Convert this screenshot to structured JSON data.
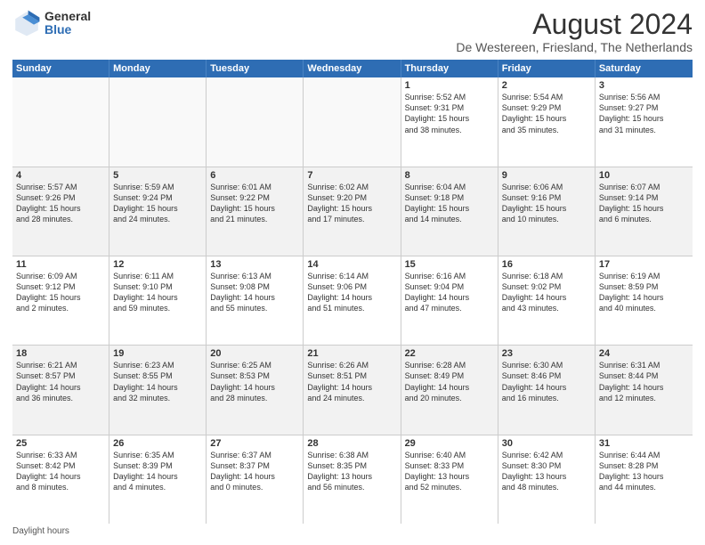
{
  "logo": {
    "general": "General",
    "blue": "Blue"
  },
  "header": {
    "title": "August 2024",
    "subtitle": "De Westereen, Friesland, The Netherlands"
  },
  "days": [
    "Sunday",
    "Monday",
    "Tuesday",
    "Wednesday",
    "Thursday",
    "Friday",
    "Saturday"
  ],
  "footer": "Daylight hours",
  "rows": [
    [
      {
        "day": "",
        "empty": true
      },
      {
        "day": "",
        "empty": true
      },
      {
        "day": "",
        "empty": true
      },
      {
        "day": "",
        "empty": true
      },
      {
        "day": "1",
        "lines": [
          "Sunrise: 5:52 AM",
          "Sunset: 9:31 PM",
          "Daylight: 15 hours",
          "and 38 minutes."
        ]
      },
      {
        "day": "2",
        "lines": [
          "Sunrise: 5:54 AM",
          "Sunset: 9:29 PM",
          "Daylight: 15 hours",
          "and 35 minutes."
        ]
      },
      {
        "day": "3",
        "lines": [
          "Sunrise: 5:56 AM",
          "Sunset: 9:27 PM",
          "Daylight: 15 hours",
          "and 31 minutes."
        ]
      }
    ],
    [
      {
        "day": "4",
        "lines": [
          "Sunrise: 5:57 AM",
          "Sunset: 9:26 PM",
          "Daylight: 15 hours",
          "and 28 minutes."
        ]
      },
      {
        "day": "5",
        "lines": [
          "Sunrise: 5:59 AM",
          "Sunset: 9:24 PM",
          "Daylight: 15 hours",
          "and 24 minutes."
        ]
      },
      {
        "day": "6",
        "lines": [
          "Sunrise: 6:01 AM",
          "Sunset: 9:22 PM",
          "Daylight: 15 hours",
          "and 21 minutes."
        ]
      },
      {
        "day": "7",
        "lines": [
          "Sunrise: 6:02 AM",
          "Sunset: 9:20 PM",
          "Daylight: 15 hours",
          "and 17 minutes."
        ]
      },
      {
        "day": "8",
        "lines": [
          "Sunrise: 6:04 AM",
          "Sunset: 9:18 PM",
          "Daylight: 15 hours",
          "and 14 minutes."
        ]
      },
      {
        "day": "9",
        "lines": [
          "Sunrise: 6:06 AM",
          "Sunset: 9:16 PM",
          "Daylight: 15 hours",
          "and 10 minutes."
        ]
      },
      {
        "day": "10",
        "lines": [
          "Sunrise: 6:07 AM",
          "Sunset: 9:14 PM",
          "Daylight: 15 hours",
          "and 6 minutes."
        ]
      }
    ],
    [
      {
        "day": "11",
        "lines": [
          "Sunrise: 6:09 AM",
          "Sunset: 9:12 PM",
          "Daylight: 15 hours",
          "and 2 minutes."
        ]
      },
      {
        "day": "12",
        "lines": [
          "Sunrise: 6:11 AM",
          "Sunset: 9:10 PM",
          "Daylight: 14 hours",
          "and 59 minutes."
        ]
      },
      {
        "day": "13",
        "lines": [
          "Sunrise: 6:13 AM",
          "Sunset: 9:08 PM",
          "Daylight: 14 hours",
          "and 55 minutes."
        ]
      },
      {
        "day": "14",
        "lines": [
          "Sunrise: 6:14 AM",
          "Sunset: 9:06 PM",
          "Daylight: 14 hours",
          "and 51 minutes."
        ]
      },
      {
        "day": "15",
        "lines": [
          "Sunrise: 6:16 AM",
          "Sunset: 9:04 PM",
          "Daylight: 14 hours",
          "and 47 minutes."
        ]
      },
      {
        "day": "16",
        "lines": [
          "Sunrise: 6:18 AM",
          "Sunset: 9:02 PM",
          "Daylight: 14 hours",
          "and 43 minutes."
        ]
      },
      {
        "day": "17",
        "lines": [
          "Sunrise: 6:19 AM",
          "Sunset: 8:59 PM",
          "Daylight: 14 hours",
          "and 40 minutes."
        ]
      }
    ],
    [
      {
        "day": "18",
        "lines": [
          "Sunrise: 6:21 AM",
          "Sunset: 8:57 PM",
          "Daylight: 14 hours",
          "and 36 minutes."
        ]
      },
      {
        "day": "19",
        "lines": [
          "Sunrise: 6:23 AM",
          "Sunset: 8:55 PM",
          "Daylight: 14 hours",
          "and 32 minutes."
        ]
      },
      {
        "day": "20",
        "lines": [
          "Sunrise: 6:25 AM",
          "Sunset: 8:53 PM",
          "Daylight: 14 hours",
          "and 28 minutes."
        ]
      },
      {
        "day": "21",
        "lines": [
          "Sunrise: 6:26 AM",
          "Sunset: 8:51 PM",
          "Daylight: 14 hours",
          "and 24 minutes."
        ]
      },
      {
        "day": "22",
        "lines": [
          "Sunrise: 6:28 AM",
          "Sunset: 8:49 PM",
          "Daylight: 14 hours",
          "and 20 minutes."
        ]
      },
      {
        "day": "23",
        "lines": [
          "Sunrise: 6:30 AM",
          "Sunset: 8:46 PM",
          "Daylight: 14 hours",
          "and 16 minutes."
        ]
      },
      {
        "day": "24",
        "lines": [
          "Sunrise: 6:31 AM",
          "Sunset: 8:44 PM",
          "Daylight: 14 hours",
          "and 12 minutes."
        ]
      }
    ],
    [
      {
        "day": "25",
        "lines": [
          "Sunrise: 6:33 AM",
          "Sunset: 8:42 PM",
          "Daylight: 14 hours",
          "and 8 minutes."
        ]
      },
      {
        "day": "26",
        "lines": [
          "Sunrise: 6:35 AM",
          "Sunset: 8:39 PM",
          "Daylight: 14 hours",
          "and 4 minutes."
        ]
      },
      {
        "day": "27",
        "lines": [
          "Sunrise: 6:37 AM",
          "Sunset: 8:37 PM",
          "Daylight: 14 hours",
          "and 0 minutes."
        ]
      },
      {
        "day": "28",
        "lines": [
          "Sunrise: 6:38 AM",
          "Sunset: 8:35 PM",
          "Daylight: 13 hours",
          "and 56 minutes."
        ]
      },
      {
        "day": "29",
        "lines": [
          "Sunrise: 6:40 AM",
          "Sunset: 8:33 PM",
          "Daylight: 13 hours",
          "and 52 minutes."
        ]
      },
      {
        "day": "30",
        "lines": [
          "Sunrise: 6:42 AM",
          "Sunset: 8:30 PM",
          "Daylight: 13 hours",
          "and 48 minutes."
        ]
      },
      {
        "day": "31",
        "lines": [
          "Sunrise: 6:44 AM",
          "Sunset: 8:28 PM",
          "Daylight: 13 hours",
          "and 44 minutes."
        ]
      }
    ]
  ]
}
